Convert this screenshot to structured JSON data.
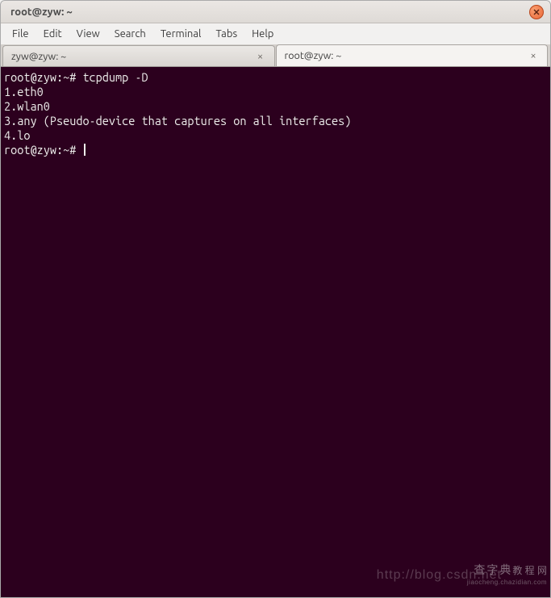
{
  "window": {
    "title": "root@zyw: ~"
  },
  "menubar": {
    "items": [
      "File",
      "Edit",
      "View",
      "Search",
      "Terminal",
      "Tabs",
      "Help"
    ]
  },
  "tabs": [
    {
      "label": "zyw@zyw: ~",
      "active": false
    },
    {
      "label": "root@zyw: ~",
      "active": true
    }
  ],
  "terminal": {
    "lines": [
      "root@zyw:~# tcpdump -D",
      "1.eth0",
      "2.wlan0",
      "3.any (Pseudo-device that captures on all interfaces)",
      "4.lo",
      "root@zyw:~# "
    ]
  },
  "watermark": {
    "url": "http://blog.csdn.net",
    "brand_cn": "查字典",
    "brand_suffix": "教 程 网",
    "brand_domain": "jiaocheng.chazidian.com"
  }
}
